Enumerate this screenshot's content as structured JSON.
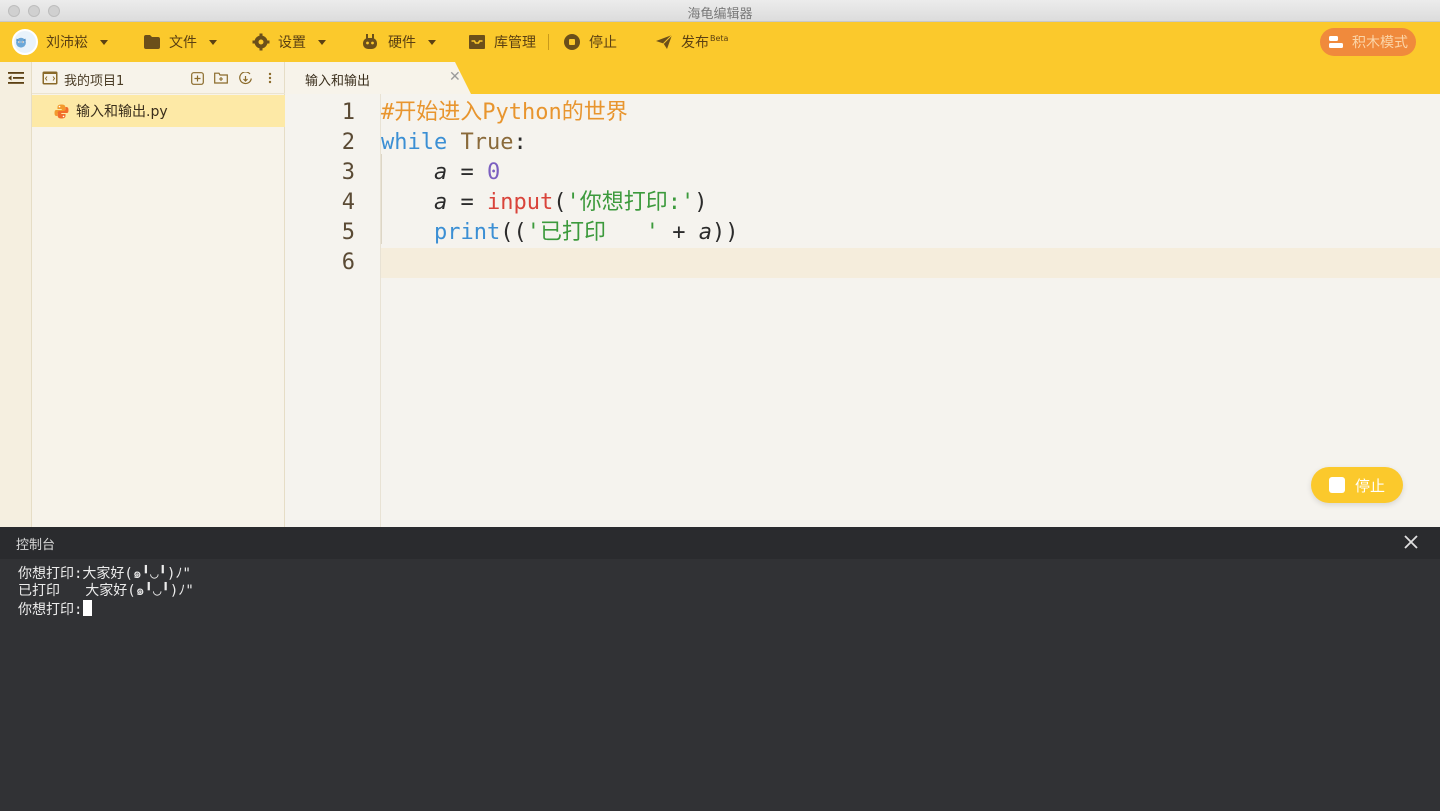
{
  "window": {
    "title": "海龟编辑器"
  },
  "menubar": {
    "user_name": "刘沛崧",
    "file_label": "文件",
    "settings_label": "设置",
    "hardware_label": "硬件",
    "library_label": "库管理",
    "stop_label": "停止",
    "publish_label": "发布",
    "publish_badge": "Beta",
    "block_mode_label": "积木模式"
  },
  "project": {
    "name": "我的项目1",
    "files": [
      {
        "name": "输入和输出.py"
      }
    ]
  },
  "tabs": [
    {
      "label": "输入和输出"
    }
  ],
  "editor": {
    "line_numbers": [
      "1",
      "2",
      "3",
      "4",
      "5",
      "6"
    ],
    "line1": {
      "comment": "#开始进入Python的世界"
    },
    "line2": {
      "kw": "while",
      "const": "True",
      "colon": ":"
    },
    "line3": {
      "var": "a",
      "op": " = ",
      "num": "0"
    },
    "line4": {
      "var": "a",
      "op": " = ",
      "builtin": "input",
      "open": "(",
      "str": "'你想打印:'",
      "close": ")"
    },
    "line5": {
      "fn": "print",
      "open": "((",
      "str": "'已打印   '",
      "op": " + ",
      "var": "a",
      "close": "))"
    }
  },
  "floating_stop_label": "停止",
  "console": {
    "title": "控制台",
    "lines": [
      "你想打印:大家好(๑╹◡╹)ﾉ\"",
      "已打印   大家好(๑╹◡╹)ﾉ\"",
      "你想打印:"
    ]
  },
  "colors": {
    "accent": "#fbc92c",
    "block_mode": "#f08a3c",
    "console_bg": "#313235",
    "selected_file": "#fde9a6"
  }
}
